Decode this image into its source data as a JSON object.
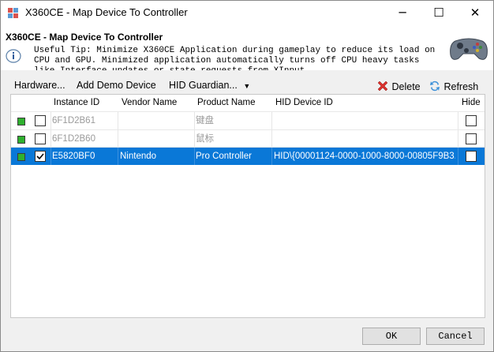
{
  "window": {
    "title": "X360CE - Map Device To Controller",
    "buttons": {
      "minimize": "─",
      "maximize": "☐",
      "close": "✕"
    }
  },
  "header": {
    "title": "X360CE - Map Device To Controller",
    "tip": "Useful Tip: Minimize X360CE Application during gameplay to reduce its load on CPU and GPU. Minimized application automatically turns off CPU heavy tasks like Interface updates or state requests from XInput.",
    "icon": "gamepad-icon"
  },
  "toolbar": {
    "hardware_label": "Hardware...",
    "add_demo_label": "Add Demo Device",
    "hid_guardian_label": "HID Guardian...",
    "delete_label": "Delete",
    "refresh_label": "Refresh"
  },
  "grid": {
    "columns": [
      "Instance ID",
      "Vendor Name",
      "Product Name",
      "HID Device ID",
      "Hide"
    ],
    "rows": [
      {
        "instance_id": "6F1D2B61",
        "vendor": "",
        "product": "键盘",
        "hid_device_id": "",
        "checked": false,
        "hide": false,
        "selected": false
      },
      {
        "instance_id": "6F1D2B60",
        "vendor": "",
        "product": "鼠标",
        "hid_device_id": "",
        "checked": false,
        "hide": false,
        "selected": false
      },
      {
        "instance_id": "E5820BF0",
        "vendor": "Nintendo",
        "product": "Pro Controller",
        "hid_device_id": "HID\\{00001124-0000-1000-8000-00805F9B3...",
        "checked": true,
        "hide": false,
        "selected": true
      }
    ],
    "status_color": "#2fb12f",
    "selection_color": "#0a78d7"
  },
  "footer": {
    "ok_label": "OK",
    "cancel_label": "Cancel"
  }
}
